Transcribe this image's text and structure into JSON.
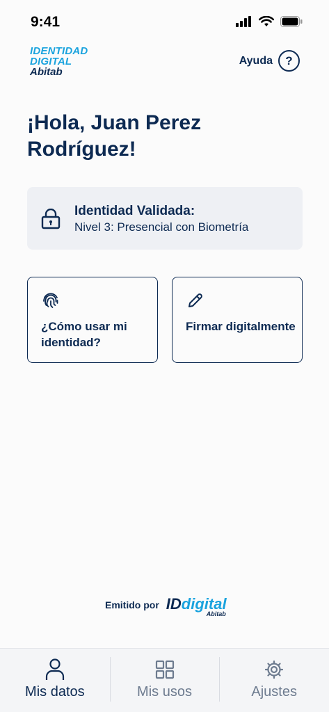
{
  "status_bar": {
    "time": "9:41"
  },
  "header": {
    "logo_line1": "IDENTIDAD",
    "logo_line2": "DIGITAL",
    "logo_line3": "Abitab",
    "help_label": "Ayuda",
    "help_symbol": "?"
  },
  "greeting": "¡Hola, Juan Perez Rodríguez!",
  "identity_card": {
    "title": "Identidad Validada:",
    "subtitle": "Nivel 3: Presencial con Biometría",
    "icon": "lock-icon"
  },
  "actions": [
    {
      "label": "¿Cómo usar mi identidad?",
      "icon": "fingerprint-icon"
    },
    {
      "label": "Firmar digitalmente",
      "icon": "pencil-icon"
    }
  ],
  "footer": {
    "emitted_label": "Emitido por",
    "logo_id": "ID",
    "logo_digital": "digital",
    "logo_abitab": "Abitab"
  },
  "tabs": [
    {
      "label": "Mis datos",
      "icon": "person-icon",
      "active": true
    },
    {
      "label": "Mis usos",
      "icon": "grid-icon",
      "active": false
    },
    {
      "label": "Ajustes",
      "icon": "gear-icon",
      "active": false
    }
  ],
  "colors": {
    "primary": "#0d2a52",
    "accent": "#1aa3de",
    "card_bg": "#eef0f4",
    "inactive_tab": "#6d7b8f"
  }
}
